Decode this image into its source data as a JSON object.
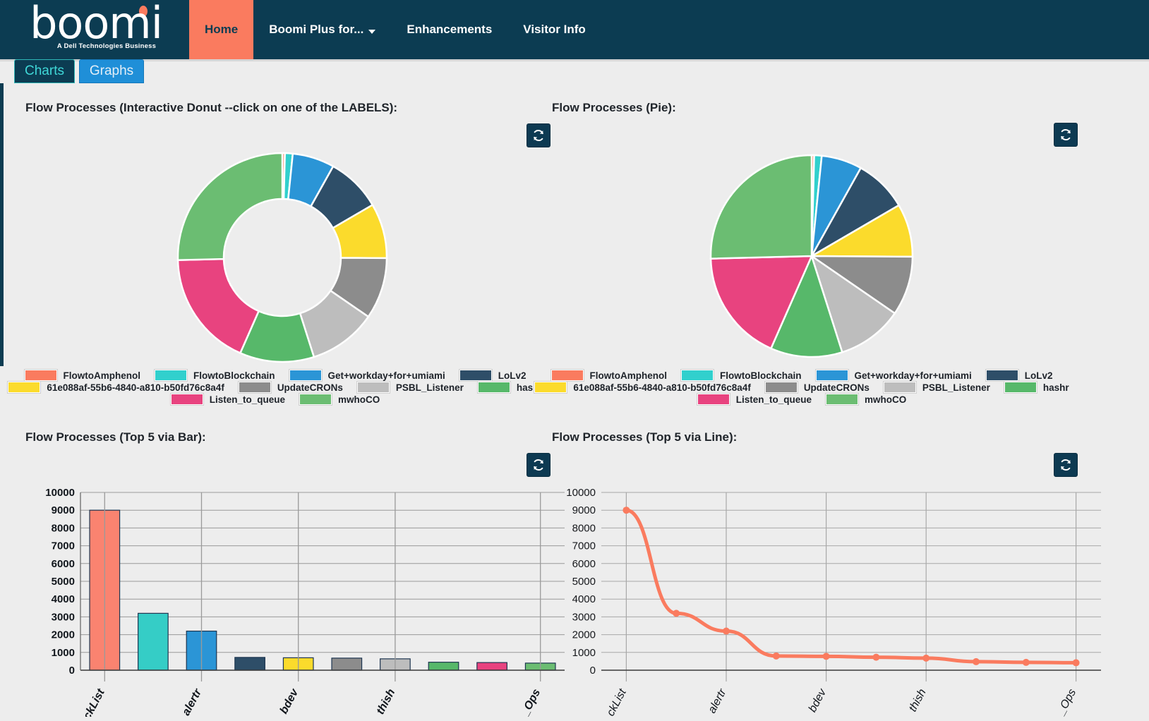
{
  "navbar": {
    "brand_word": "boomi",
    "brand_tagline": "A Dell Technologies Business",
    "items": [
      {
        "label": "Home",
        "active": true,
        "caret": false
      },
      {
        "label": "Boomi Plus for...",
        "active": false,
        "caret": true
      },
      {
        "label": "Enhancements",
        "active": false,
        "caret": false
      },
      {
        "label": "Visitor Info",
        "active": false,
        "caret": false
      }
    ]
  },
  "tabs": [
    {
      "label": "Charts",
      "active": false
    },
    {
      "label": "Graphs",
      "active": true
    }
  ],
  "icons": {
    "refresh": "refresh-icon"
  },
  "panels": {
    "donut": {
      "title": "Flow Processes (Interactive Donut --click on one of the LABELS):"
    },
    "pie": {
      "title": "Flow Processes (Pie):"
    },
    "bar": {
      "title": "Flow Processes (Top 5 via Bar):"
    },
    "line": {
      "title": "Flow Processes (Top 5 via Line):"
    }
  },
  "colors": {
    "navy": "#0c3c52",
    "accent_orange": "#fa7b5f",
    "tab_blue": "#1f8fd8",
    "tab_cyan_text": "#3fd8d8",
    "plot_bg": "#ededed"
  },
  "chart_data": [
    {
      "type": "pie",
      "title": "Flow Processes (Interactive Donut --click on one of the LABELS):",
      "variant": "donut",
      "legend_position": "bottom",
      "labels": [
        "FlowtoAmphenol",
        "FlowtoBlockchain",
        "Get+workday+for+umiami",
        "LoLv2",
        "61e088af-55b6-4840-a810-b50fd76c8a4f",
        "UpdateCRONs",
        "PSBL_Listener",
        "hashr",
        "Listen_to_queue",
        "mwhoCO"
      ],
      "values": [
        0.4,
        1.2,
        6.5,
        8.5,
        8.5,
        9.5,
        10.5,
        11.5,
        18.0,
        25.4
      ],
      "colors": [
        "#fa7b5f",
        "#31d0cd",
        "#2b95d6",
        "#2e4e68",
        "#fbdb2c",
        "#8c8c8c",
        "#bdbdbd",
        "#57b86a",
        "#e8437f",
        "#6bbd72"
      ]
    },
    {
      "type": "pie",
      "title": "Flow Processes (Pie):",
      "variant": "pie",
      "legend_position": "bottom",
      "labels": [
        "FlowtoAmphenol",
        "FlowtoBlockchain",
        "Get+workday+for+umiami",
        "LoLv2",
        "61e088af-55b6-4840-a810-b50fd76c8a4f",
        "UpdateCRONs",
        "PSBL_Listener",
        "hashr",
        "Listen_to_queue",
        "mwhoCO"
      ],
      "values": [
        0.4,
        1.2,
        6.5,
        8.5,
        8.5,
        9.5,
        10.5,
        11.5,
        18.0,
        25.4
      ],
      "colors": [
        "#fa7b5f",
        "#31d0cd",
        "#2b95d6",
        "#2e4e68",
        "#fbdb2c",
        "#8c8c8c",
        "#bdbdbd",
        "#57b86a",
        "#e8437f",
        "#6bbd72"
      ]
    },
    {
      "type": "bar",
      "title": "Flow Processes (Top 5 via Bar):",
      "categories": [
        "ckList",
        "alertr",
        "bdev",
        "thish",
        "_Ops"
      ],
      "bar_labels": [
        "ckList",
        "",
        "alertr",
        "",
        "bdev",
        "",
        "thish",
        "",
        "",
        "_Ops"
      ],
      "values": [
        9000,
        3200,
        2200,
        720,
        700,
        680,
        640,
        450,
        430,
        400
      ],
      "bar_colors": [
        "#fa8370",
        "#35cdc6",
        "#2b95d6",
        "#2e4e68",
        "#fbdb2c",
        "#8c8c8c",
        "#bdbdbd",
        "#57b86a",
        "#e8437f",
        "#6bbd72"
      ],
      "yticks": [
        10000,
        9000,
        8000,
        7000,
        6000,
        5000,
        4000,
        3000,
        2000,
        1000,
        0
      ],
      "ylim": [
        0,
        10000
      ],
      "grid": true,
      "xlabel": "",
      "ylabel": ""
    },
    {
      "type": "line",
      "title": "Flow Processes (Top 5 via Line):",
      "categories": [
        "ckList",
        "alertr",
        "bdev",
        "thish",
        "_Ops"
      ],
      "x": [
        0,
        1,
        2,
        3,
        4,
        5,
        6,
        7,
        8,
        9
      ],
      "values": [
        9000,
        3200,
        2200,
        800,
        780,
        730,
        680,
        480,
        440,
        420
      ],
      "line_color": "#fa7b5f",
      "marker_color": "#fa7b5f",
      "yticks": [
        10000,
        9000,
        8000,
        7000,
        6000,
        5000,
        4000,
        3000,
        2000,
        1000,
        0
      ],
      "ylim": [
        0,
        10000
      ],
      "grid": true,
      "xlabel": "",
      "ylabel": ""
    }
  ]
}
